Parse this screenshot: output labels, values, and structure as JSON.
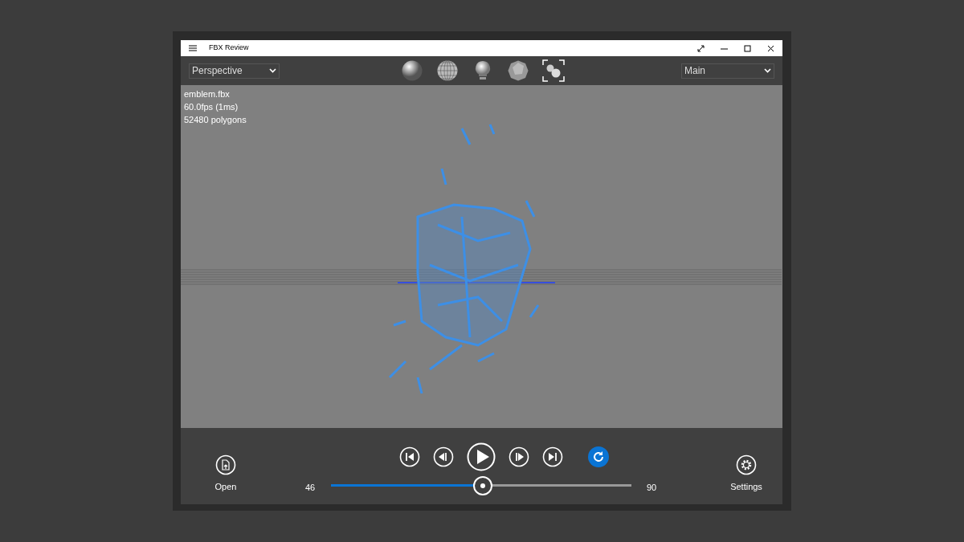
{
  "window": {
    "title": "FBX Review"
  },
  "toolbar": {
    "camera": "Perspective",
    "take": "Main",
    "modes": [
      {
        "kind": "shaded",
        "selected": false
      },
      {
        "kind": "wireframe",
        "selected": false
      },
      {
        "kind": "light",
        "selected": false
      },
      {
        "kind": "faceted",
        "selected": false
      },
      {
        "kind": "frame",
        "selected": false
      }
    ]
  },
  "viewport": {
    "info": [
      "emblem.fbx",
      "60.0fps (1ms)",
      "52480 polygons"
    ]
  },
  "playback": {
    "open_label": "Open",
    "settings_label": "Settings",
    "start_frame": "46",
    "end_frame": "90",
    "level": 0.505,
    "loop": {
      "on": true
    }
  }
}
